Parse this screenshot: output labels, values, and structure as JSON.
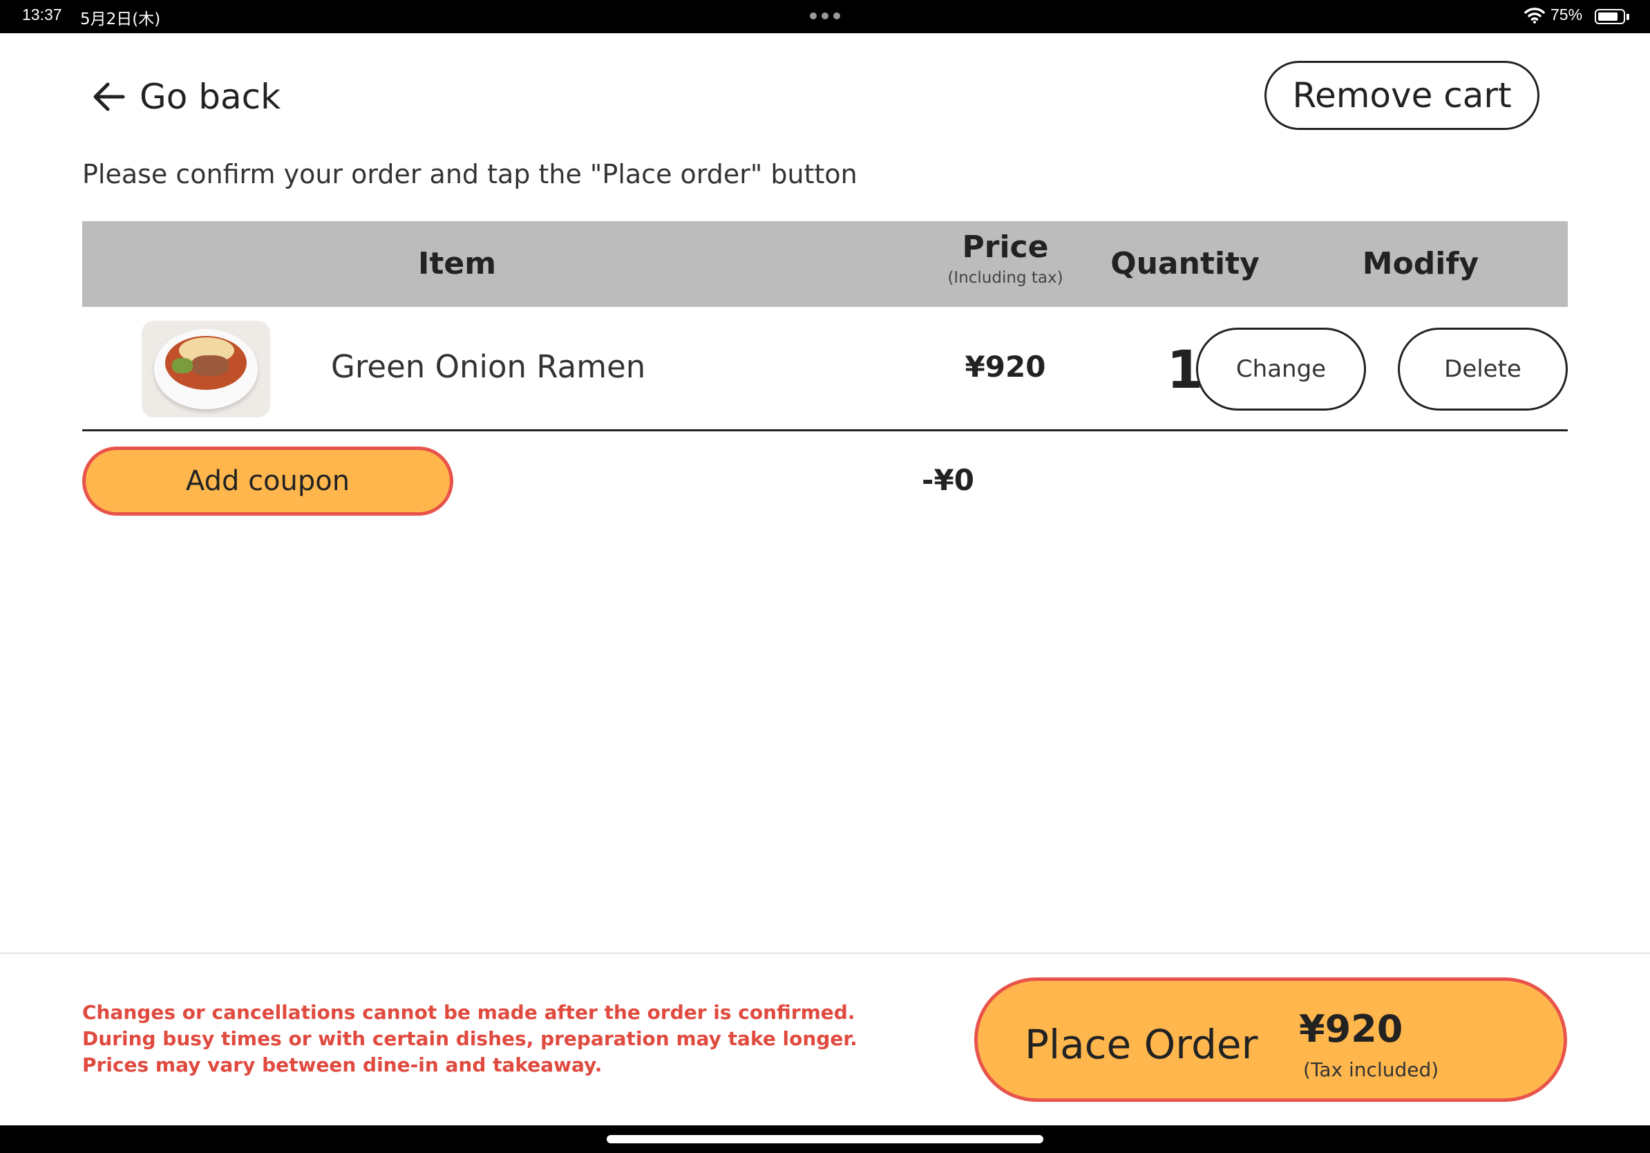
{
  "status_bar": {
    "time": "13:37",
    "date": "5月2日(木)",
    "battery_percent": "75%",
    "battery_level": 0.75,
    "wifi_icon": "wifi-icon",
    "more_icon": "ellipsis-icon"
  },
  "nav": {
    "back_label": "Go back",
    "back_icon": "arrow-left-icon",
    "remove_cart_label": "Remove cart"
  },
  "instruction": "Please confirm your order and tap the \"Place order\" button",
  "table": {
    "headers": {
      "item": "Item",
      "price": "Price",
      "price_note": "(Including tax)",
      "quantity": "Quantity",
      "modify": "Modify"
    },
    "rows": [
      {
        "name": "Green Onion Ramen",
        "price": "¥920",
        "quantity": "1",
        "change_label": "Change",
        "delete_label": "Delete"
      }
    ]
  },
  "coupon": {
    "button_label": "Add coupon",
    "discount": "-¥0"
  },
  "notices": [
    "Changes or cancellations cannot be made after the order is confirmed.",
    "During busy times or with certain dishes, preparation may take longer.",
    "Prices may vary between dine-in and takeaway."
  ],
  "place_order": {
    "label": "Place Order",
    "total": "¥920",
    "tax_note": "(Tax included)"
  },
  "colors": {
    "accent": "#ffb74d",
    "accent_border": "#e8534b",
    "notice_text": "#e04a3f",
    "header_bg": "#bcbcbc"
  }
}
